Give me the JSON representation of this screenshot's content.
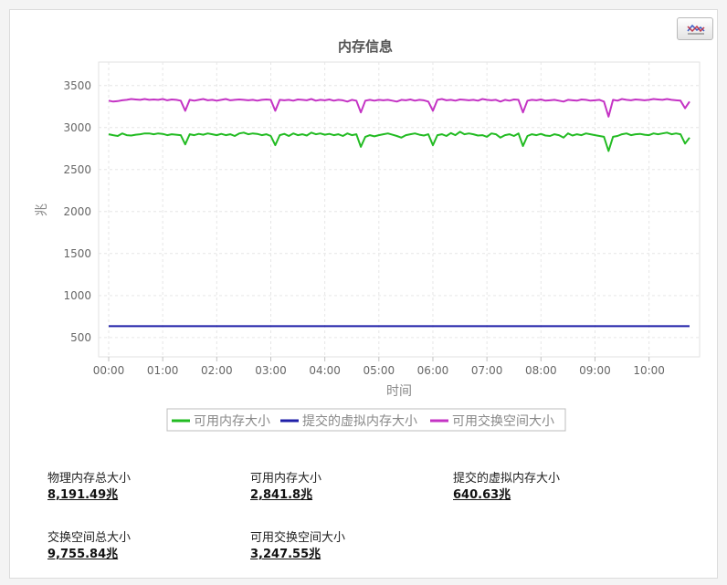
{
  "chart_data": {
    "type": "line",
    "title": "内存信息",
    "xlabel": "时间",
    "ylabel": "兆",
    "x_range_hours": [
      0,
      10.75
    ],
    "xticks": [
      "00:00",
      "01:00",
      "02:00",
      "03:00",
      "04:00",
      "05:00",
      "06:00",
      "07:00",
      "08:00",
      "09:00",
      "10:00"
    ],
    "yticks": [
      500,
      1000,
      1500,
      2000,
      2500,
      3000,
      3500
    ],
    "ylim": [
      270,
      3780
    ],
    "grid": true,
    "legend_position": "bottom",
    "x": [
      "00:00",
      "00:05",
      "00:10",
      "00:15",
      "00:20",
      "00:25",
      "00:30",
      "00:35",
      "00:40",
      "00:45",
      "00:50",
      "00:55",
      "01:00",
      "01:05",
      "01:10",
      "01:15",
      "01:20",
      "01:25",
      "01:30",
      "01:35",
      "01:40",
      "01:45",
      "01:50",
      "01:55",
      "02:00",
      "02:05",
      "02:10",
      "02:15",
      "02:20",
      "02:25",
      "02:30",
      "02:35",
      "02:40",
      "02:45",
      "02:50",
      "02:55",
      "03:00",
      "03:05",
      "03:10",
      "03:15",
      "03:20",
      "03:25",
      "03:30",
      "03:35",
      "03:40",
      "03:45",
      "03:50",
      "03:55",
      "04:00",
      "04:05",
      "04:10",
      "04:15",
      "04:20",
      "04:25",
      "04:30",
      "04:35",
      "04:40",
      "04:45",
      "04:50",
      "04:55",
      "05:00",
      "05:05",
      "05:10",
      "05:15",
      "05:20",
      "05:25",
      "05:30",
      "05:35",
      "05:40",
      "05:45",
      "05:50",
      "05:55",
      "06:00",
      "06:05",
      "06:10",
      "06:15",
      "06:20",
      "06:25",
      "06:30",
      "06:35",
      "06:40",
      "06:45",
      "06:50",
      "06:55",
      "07:00",
      "07:05",
      "07:10",
      "07:15",
      "07:20",
      "07:25",
      "07:30",
      "07:35",
      "07:40",
      "07:45",
      "07:50",
      "07:55",
      "08:00",
      "08:05",
      "08:10",
      "08:15",
      "08:20",
      "08:25",
      "08:30",
      "08:35",
      "08:40",
      "08:45",
      "08:50",
      "08:55",
      "09:00",
      "09:05",
      "09:10",
      "09:15",
      "09:20",
      "09:25",
      "09:30",
      "09:35",
      "09:40",
      "09:45",
      "09:50",
      "09:55",
      "10:00",
      "10:05",
      "10:10",
      "10:15",
      "10:20",
      "10:25",
      "10:30",
      "10:35",
      "10:40",
      "10:45"
    ],
    "series": [
      {
        "name": "可用内存大小",
        "color": "#22bb22",
        "values": [
          2920,
          2910,
          2900,
          2930,
          2910,
          2905,
          2915,
          2920,
          2930,
          2930,
          2920,
          2930,
          2925,
          2910,
          2920,
          2915,
          2910,
          2800,
          2920,
          2910,
          2925,
          2915,
          2930,
          2920,
          2910,
          2925,
          2910,
          2920,
          2900,
          2930,
          2940,
          2920,
          2930,
          2925,
          2910,
          2920,
          2900,
          2790,
          2910,
          2925,
          2900,
          2930,
          2910,
          2920,
          2905,
          2940,
          2920,
          2930,
          2915,
          2925,
          2910,
          2920,
          2900,
          2930,
          2910,
          2920,
          2770,
          2890,
          2910,
          2895,
          2910,
          2920,
          2930,
          2915,
          2900,
          2880,
          2910,
          2920,
          2930,
          2915,
          2905,
          2920,
          2790,
          2910,
          2920,
          2900,
          2935,
          2910,
          2950,
          2920,
          2930,
          2920,
          2905,
          2910,
          2890,
          2930,
          2920,
          2880,
          2910,
          2920,
          2900,
          2930,
          2780,
          2900,
          2920,
          2910,
          2925,
          2905,
          2900,
          2920,
          2910,
          2880,
          2930,
          2905,
          2920,
          2910,
          2930,
          2920,
          2910,
          2900,
          2890,
          2720,
          2890,
          2900,
          2920,
          2930,
          2910,
          2920,
          2925,
          2915,
          2910,
          2930,
          2920,
          2930,
          2940,
          2920,
          2930,
          2920,
          2810,
          2880,
          2890,
          2890
        ]
      },
      {
        "name": "提交的虚拟内存大小",
        "color": "#1f1fa8",
        "values": [
          635,
          635,
          635,
          635,
          635,
          635,
          635,
          635,
          635,
          635,
          635,
          635,
          635,
          635,
          635,
          635,
          635,
          635,
          635,
          635,
          635,
          635,
          635,
          635,
          635,
          635,
          635,
          635,
          635,
          635,
          635,
          635,
          635,
          635,
          635,
          635,
          635,
          635,
          635,
          635,
          635,
          635,
          635,
          635,
          635,
          635,
          635,
          635,
          635,
          635,
          635,
          635,
          635,
          635,
          635,
          635,
          635,
          635,
          635,
          635,
          635,
          635,
          635,
          635,
          635,
          635,
          635,
          635,
          635,
          635,
          635,
          635,
          635,
          635,
          635,
          635,
          635,
          635,
          635,
          635,
          635,
          635,
          635,
          635,
          635,
          635,
          635,
          635,
          635,
          635,
          635,
          635,
          635,
          635,
          635,
          635,
          635,
          635,
          635,
          635,
          635,
          635,
          635,
          635,
          635,
          635,
          635,
          635,
          635,
          635,
          635,
          635,
          635,
          635,
          635,
          635,
          635,
          635,
          635,
          635,
          635,
          635,
          635,
          635,
          635,
          635,
          635,
          635,
          635,
          635,
          635,
          635
        ]
      },
      {
        "name": "可用交换空间大小",
        "color": "#c433c4",
        "values": [
          3320,
          3310,
          3315,
          3325,
          3330,
          3340,
          3335,
          3330,
          3340,
          3330,
          3335,
          3330,
          3340,
          3325,
          3335,
          3330,
          3320,
          3200,
          3330,
          3320,
          3330,
          3340,
          3325,
          3330,
          3320,
          3330,
          3340,
          3325,
          3330,
          3335,
          3330,
          3325,
          3330,
          3320,
          3330,
          3335,
          3330,
          3200,
          3330,
          3325,
          3330,
          3320,
          3335,
          3330,
          3325,
          3340,
          3320,
          3330,
          3325,
          3335,
          3320,
          3330,
          3325,
          3310,
          3330,
          3320,
          3180,
          3320,
          3330,
          3320,
          3330,
          3325,
          3330,
          3320,
          3310,
          3330,
          3325,
          3335,
          3320,
          3330,
          3325,
          3310,
          3200,
          3330,
          3340,
          3325,
          3330,
          3320,
          3335,
          3330,
          3325,
          3330,
          3320,
          3340,
          3330,
          3325,
          3330,
          3310,
          3330,
          3320,
          3335,
          3330,
          3180,
          3320,
          3330,
          3325,
          3335,
          3320,
          3325,
          3330,
          3320,
          3310,
          3330,
          3325,
          3320,
          3335,
          3330,
          3320,
          3325,
          3330,
          3310,
          3130,
          3330,
          3320,
          3340,
          3330,
          3325,
          3335,
          3330,
          3325,
          3330,
          3340,
          3335,
          3330,
          3340,
          3330,
          3325,
          3320,
          3230,
          3310,
          3330,
          3320
        ]
      }
    ]
  },
  "stats": [
    {
      "label": "物理内存总大小",
      "value": "8,191.49兆"
    },
    {
      "label": "可用内存大小",
      "value": "2,841.8兆"
    },
    {
      "label": "提交的虚拟内存大小",
      "value": "640.63兆"
    },
    {
      "label": "交换空间总大小",
      "value": "9,755.84兆"
    },
    {
      "label": "可用交换空间大小",
      "value": "3,247.55兆"
    }
  ],
  "export_button": {
    "icon": "chart-export-icon"
  },
  "colors": {
    "grid": "#e6e6e6",
    "axis": "#c0c0c0",
    "tick_text": "#666666",
    "title": "#555555"
  }
}
